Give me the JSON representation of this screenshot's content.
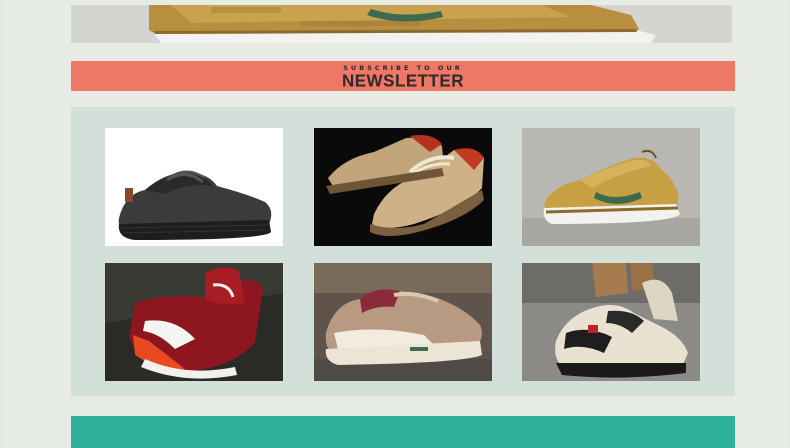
{
  "newsletter": {
    "kicker": "SUBSCRIBE TO OUR",
    "title": "NEWSLETTER"
  },
  "colors": {
    "page_bg": "#e6ece3",
    "newsletter_bg": "#ee7766",
    "grid_bg": "#d3e0d9",
    "footer_bar": "#2eb09a"
  },
  "products": [
    {
      "description": "black knit sneaker on white background"
    },
    {
      "description": "tan knit sneakers with red lining on black background"
    },
    {
      "description": "gold sneaker with green swoosh on concrete"
    },
    {
      "description": "red and white sneaker on dark ground"
    },
    {
      "description": "tan and burgundy runner sneaker on gravel"
    },
    {
      "description": "cream, black and red runner sneaker on pavement"
    }
  ]
}
